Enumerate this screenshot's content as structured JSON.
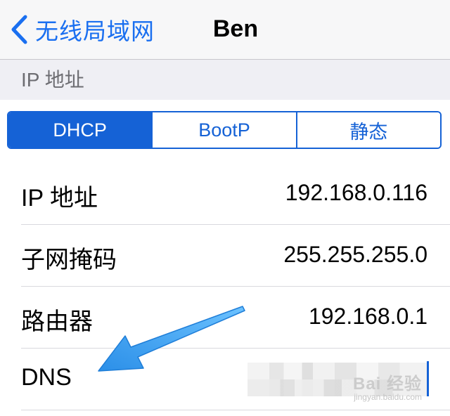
{
  "navbar": {
    "back_label": "无线局域网",
    "title": "Ben"
  },
  "section": {
    "header": "IP 地址"
  },
  "segments": [
    {
      "label": "DHCP",
      "active": true
    },
    {
      "label": "BootP",
      "active": false
    },
    {
      "label": "静态",
      "active": false
    }
  ],
  "rows": [
    {
      "label": "IP 地址",
      "value": "192.168.0.116"
    },
    {
      "label": "子网掩码",
      "value": "255.255.255.0"
    },
    {
      "label": "路由器",
      "value": "192.168.0.1"
    },
    {
      "label": "DNS",
      "value": ""
    }
  ],
  "watermark": {
    "text": "Bai 经验",
    "sub": "jingyan.baidu.com"
  },
  "colors": {
    "accent": "#1562d6",
    "back_tint": "#1a6ff0",
    "annotation_arrow": "#3aa0f0"
  },
  "icons": {
    "back": "chevron-left-icon",
    "annotation": "arrow-annotation-icon"
  }
}
